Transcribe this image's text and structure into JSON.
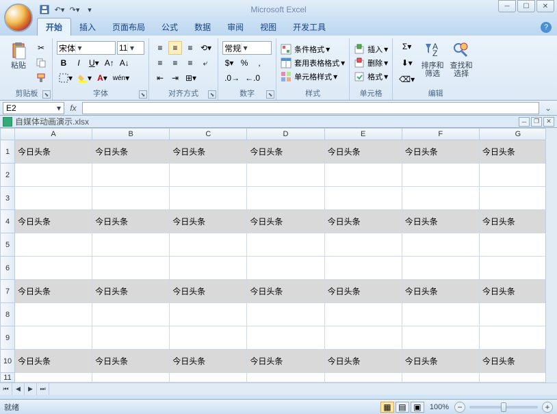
{
  "app_title": "Microsoft Excel",
  "workbook_name": "自媒体动画演示.xlsx",
  "tabs": [
    "开始",
    "插入",
    "页面布局",
    "公式",
    "数据",
    "审阅",
    "视图",
    "开发工具"
  ],
  "active_tab": 0,
  "clipboard": {
    "paste": "粘贴",
    "title": "剪贴板"
  },
  "font": {
    "title": "字体",
    "name": "宋体",
    "size": "11"
  },
  "alignment": {
    "title": "对齐方式"
  },
  "number": {
    "title": "数字",
    "format": "常规"
  },
  "styles": {
    "title": "样式",
    "conditional": "条件格式",
    "table": "套用表格格式",
    "cell": "单元格样式"
  },
  "cells": {
    "title": "单元格",
    "insert": "插入",
    "delete": "删除",
    "format": "格式"
  },
  "editing": {
    "title": "编辑",
    "sort": "排序和\n筛选",
    "find": "查找和\n选择"
  },
  "namebox": "E2",
  "columns": [
    "A",
    "B",
    "C",
    "D",
    "E",
    "F",
    "G"
  ],
  "rows": [
    1,
    2,
    3,
    4,
    5,
    6,
    7,
    8,
    9,
    10,
    11
  ],
  "cell_text": "今日头条",
  "banded_rows": [
    1,
    4,
    7,
    10
  ],
  "status": "就绪",
  "zoom": "100%"
}
